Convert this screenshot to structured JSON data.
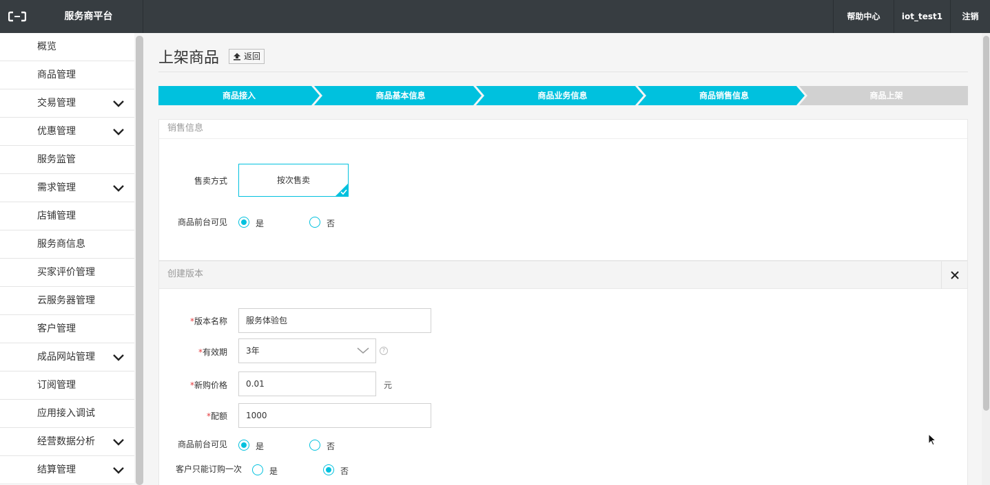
{
  "topbar": {
    "brand": "服务商平台",
    "help": "帮助中心",
    "user": "iot_test1",
    "logout": "注销"
  },
  "sidebar": {
    "items": [
      {
        "label": "概览",
        "expandable": false
      },
      {
        "label": "商品管理",
        "expandable": false
      },
      {
        "label": "交易管理",
        "expandable": true
      },
      {
        "label": "优惠管理",
        "expandable": true
      },
      {
        "label": "服务监管",
        "expandable": false
      },
      {
        "label": "需求管理",
        "expandable": true
      },
      {
        "label": "店铺管理",
        "expandable": false
      },
      {
        "label": "服务商信息",
        "expandable": false
      },
      {
        "label": "买家评价管理",
        "expandable": false
      },
      {
        "label": "云服务器管理",
        "expandable": false
      },
      {
        "label": "客户管理",
        "expandable": false
      },
      {
        "label": "成品网站管理",
        "expandable": true
      },
      {
        "label": "订阅管理",
        "expandable": false
      },
      {
        "label": "应用接入调试",
        "expandable": false
      },
      {
        "label": "经营数据分析",
        "expandable": true
      },
      {
        "label": "结算管理",
        "expandable": true
      }
    ]
  },
  "page": {
    "title": "上架商品",
    "back": "返回"
  },
  "steps": [
    {
      "label": "商品接入",
      "active": true
    },
    {
      "label": "商品基本信息",
      "active": true
    },
    {
      "label": "商品业务信息",
      "active": true
    },
    {
      "label": "商品销售信息",
      "active": true
    },
    {
      "label": "商品上架",
      "active": false
    }
  ],
  "sales": {
    "heading": "销售信息",
    "method_label": "售卖方式",
    "method_value": "按次售卖",
    "visible_label": "商品前台可见",
    "yes": "是",
    "no": "否",
    "visible_selected": "是"
  },
  "version": {
    "heading": "创建版本",
    "name_label": "版本名称",
    "name_value": "服务体验包",
    "validity_label": "有效期",
    "validity_value": "3年",
    "price_label": "新购价格",
    "price_value": "0.01",
    "price_unit": "元",
    "quota_label": "配额",
    "quota_value": "1000",
    "visible_label": "商品前台可见",
    "visible_selected": "是",
    "once_label": "客户只能订购一次",
    "once_selected": "否",
    "yes": "是",
    "no": "否",
    "required_mark": "*"
  },
  "colors": {
    "accent": "#00c1de",
    "topbar": "#373d41",
    "step_inactive": "#d1d1d1"
  }
}
